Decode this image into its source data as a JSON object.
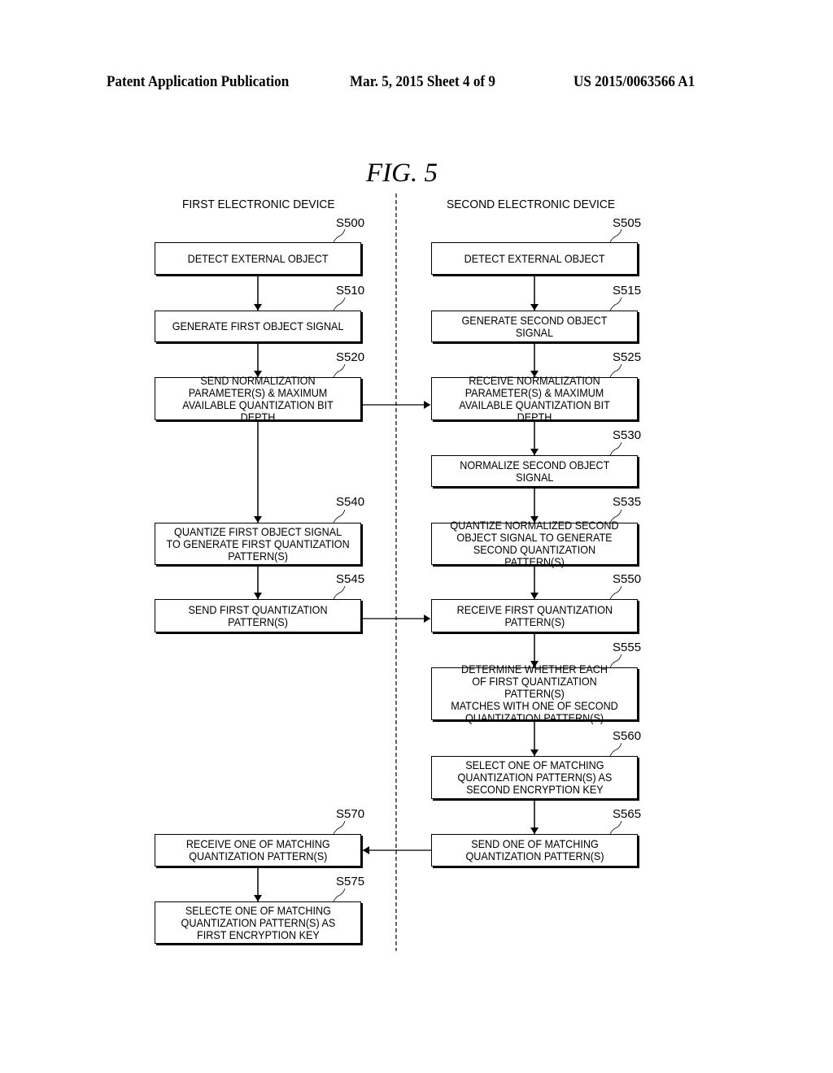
{
  "header": {
    "left": "Patent Application Publication",
    "middle": "Mar. 5, 2015   Sheet 4 of 9",
    "right": "US 2015/0063566 A1"
  },
  "figure": {
    "title": "FIG. 5",
    "columns": {
      "first": "FIRST ELECTRONIC DEVICE",
      "second": "SECOND ELECTRONIC DEVICE"
    },
    "steps": {
      "s500": {
        "id": "S500",
        "text": "DETECT EXTERNAL OBJECT"
      },
      "s505": {
        "id": "S505",
        "text": "DETECT EXTERNAL OBJECT"
      },
      "s510": {
        "id": "S510",
        "text": "GENERATE FIRST OBJECT SIGNAL"
      },
      "s515": {
        "id": "S515",
        "text": "GENERATE SECOND OBJECT SIGNAL"
      },
      "s520": {
        "id": "S520",
        "text": "SEND NORMALIZATION\nPARAMETER(S) & MAXIMUM\nAVAILABLE QUANTIZATION BIT DEPTH"
      },
      "s525": {
        "id": "S525",
        "text": "RECEIVE NORMALIZATION\nPARAMETER(S) & MAXIMUM\nAVAILABLE QUANTIZATION BIT DEPTH"
      },
      "s530": {
        "id": "S530",
        "text": "NORMALIZE SECOND OBJECT\nSIGNAL"
      },
      "s535": {
        "id": "S535",
        "text": "QUANTIZE NORMALIZED SECOND\nOBJECT SIGNAL TO GENERATE\nSECOND QUANTIZATION PATTERN(S)"
      },
      "s540": {
        "id": "S540",
        "text": "QUANTIZE FIRST OBJECT SIGNAL\nTO GENERATE FIRST QUANTIZATION\nPATTERN(S)"
      },
      "s545": {
        "id": "S545",
        "text": "SEND FIRST QUANTIZATION\nPATTERN(S)"
      },
      "s550": {
        "id": "S550",
        "text": "RECEIVE FIRST QUANTIZATION\nPATTERN(S)"
      },
      "s555": {
        "id": "S555",
        "text": "DETERMINE WHETHER EACH\nOF FIRST QUANTIZATION PATTERN(S)\nMATCHES WITH ONE OF SECOND\nQUANTIZATION PATTERN(S)"
      },
      "s560": {
        "id": "S560",
        "text": "SELECT ONE OF MATCHING\nQUANTIZATION PATTERN(S) AS\nSECOND ENCRYPTION KEY"
      },
      "s565": {
        "id": "S565",
        "text": "SEND ONE OF MATCHING\nQUANTIZATION PATTERN(S)"
      },
      "s570": {
        "id": "S570",
        "text": "RECEIVE ONE OF MATCHING\nQUANTIZATION PATTERN(S)"
      },
      "s575": {
        "id": "S575",
        "text": "SELECTE ONE OF MATCHING\nQUANTIZATION PATTERN(S) AS\nFIRST ENCRYPTION KEY"
      }
    }
  }
}
